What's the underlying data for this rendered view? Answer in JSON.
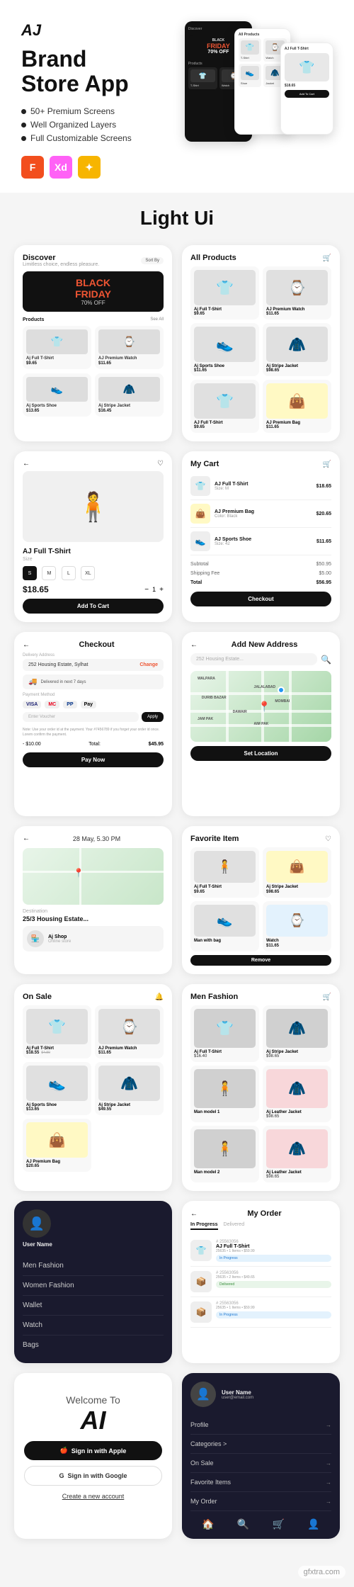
{
  "hero": {
    "logo": "AJ",
    "title": "Brand\nStore App",
    "bullets": [
      "50+ Premium Screens",
      "Well Organized Layers",
      "Full Customizable Screens"
    ],
    "tools": [
      "F",
      "Xd",
      "✦"
    ],
    "tool_labels": [
      "Figma",
      "Adobe XD",
      "Sketch"
    ]
  },
  "section_light_ui": "Light Ui",
  "screens": {
    "discover": {
      "title": "Discover",
      "subtitle": "Limitless choice, endless pleasure.",
      "sort_label": "Sort By",
      "banner": {
        "sale": "BLACK",
        "sale2": "FRIDAY",
        "discount": "70% OFF"
      },
      "products_label": "Products",
      "see_all": "See All",
      "items": [
        {
          "name": "Aj Full T-Shirt",
          "price": "$9.65",
          "old": ""
        },
        {
          "name": "AJ Premium Watch",
          "price": "$11.65",
          "old": ""
        },
        {
          "name": "Aj Sports Shoe",
          "price": "$13.65",
          "old": ""
        },
        {
          "name": "Aj Stripe Jacket",
          "price": "$16.45",
          "old": ""
        }
      ]
    },
    "all_products": {
      "title": "All Products",
      "items": [
        {
          "name": "Aj Full T-Shirt",
          "price": "$9.65"
        },
        {
          "name": "AJ Premium Watch",
          "price": "$11.65"
        },
        {
          "name": "Aj Sports Shoe",
          "price": "$11.65"
        },
        {
          "name": "Aj Stripe Jacket",
          "price": "$98.65"
        },
        {
          "name": "AJ Full T-Shirt",
          "price": "$9.65"
        },
        {
          "name": "AJ Premium Bag",
          "price": "$11.65"
        }
      ]
    },
    "product_detail": {
      "name": "AJ Full T-Shirt",
      "size_label": "Size",
      "sizes": [
        "S",
        "M",
        "L",
        "XL"
      ],
      "active_size": "S",
      "price": "$18.65",
      "old_price": "",
      "qty": 1,
      "add_to_cart": "Add To Cart"
    },
    "cart": {
      "title": "My Cart",
      "items": [
        {
          "name": "AJ Full T-Shirt",
          "sub": "Size: M",
          "price": "$18.65",
          "emoji": "👕"
        },
        {
          "name": "AJ Premium Bag",
          "sub": "Color: Black",
          "price": "$20.65",
          "emoji": "👜"
        },
        {
          "name": "AJ Sports Shoe",
          "sub": "Size: 42",
          "price": "$11.65",
          "emoji": "👟"
        }
      ],
      "subtotal_label": "Subtotal",
      "subtotal": "$50.95",
      "shipping_label": "Shipping Fee",
      "shipping": "$5.00",
      "total_label": "Total",
      "total": "$56.95",
      "checkout_btn": "Checkout"
    },
    "checkout": {
      "title": "Checkout",
      "address_label": "Delivery Address",
      "address_value": "252 Housing Estate, Sylhat",
      "change": "Change",
      "delivery_label": "Delivered in next 7 days",
      "payment_label": "Payment Method",
      "payment_methods": [
        "VISA",
        "MC",
        "PP",
        "Pay"
      ],
      "coupon_placeholder": "Enter Voucher",
      "note": "Note: Use your order id at the payment. Your #7456789 if you forget your order id once. Lorem confirm the payment.",
      "total_label": "Total:",
      "total": "$45.95",
      "tax_label": "- $10.00",
      "pay_now": "Pay Now"
    },
    "map": {
      "title": "Add New Address",
      "search_placeholder": "252 Housing Estate...",
      "set_location_btn": "Set Location"
    },
    "notification": {
      "title": "28 May, 5.30 PM",
      "subtitle": "Destination",
      "value": "25/3 Housing Estate...",
      "shop": "Aj Shop"
    },
    "favorite": {
      "title": "Favorite Item",
      "items": [
        {
          "name": "Aj Full T-Shirt",
          "price": "$9.65",
          "emoji": "👕"
        },
        {
          "name": "Aj Stripe Jacket",
          "price": "$98.65",
          "emoji": "🧥"
        },
        {
          "name": "Man with bag",
          "price": "",
          "emoji": "🧍"
        },
        {
          "name": "Watch",
          "price": "$11.65",
          "emoji": "⌚"
        }
      ],
      "remove_btn": "Remove"
    },
    "on_sale": {
      "title": "On Sale",
      "items": [
        {
          "name": "Aj Full T-Shirt",
          "price": "$18.55",
          "old": "$4.80",
          "emoji": "👕"
        },
        {
          "name": "AJ Premium Watch",
          "price": "$11.65",
          "old": "",
          "emoji": "⌚"
        },
        {
          "name": "Aj Sports Shoe",
          "price": "$13.65",
          "old": "",
          "emoji": "👟"
        },
        {
          "name": "Aj Stripe Jacket",
          "price": "$49.55",
          "old": "",
          "emoji": "🧥"
        },
        {
          "name": "AJ Premium Bag",
          "price": "$20.65",
          "old": "",
          "emoji": "👜"
        }
      ]
    },
    "men_fashion": {
      "title": "Men Fashion",
      "items": [
        {
          "name": "Aj Full T-Shirt",
          "price": "$16.40",
          "emoji": "👕"
        },
        {
          "name": "Aj Stripe Jacket",
          "price": "$98.65",
          "emoji": "🧥"
        },
        {
          "name": "Man model 1",
          "price": "",
          "emoji": "🧍"
        },
        {
          "name": "Aj Leather Jacket",
          "price": "$98.65",
          "emoji": "🧥"
        },
        {
          "name": "Man model 2",
          "price": "",
          "emoji": "🧍"
        },
        {
          "name": "Aj Leather Jacket",
          "price": "$98.65",
          "emoji": "🧥"
        }
      ]
    },
    "my_order": {
      "title": "My Order",
      "items": [
        {
          "id": "# 25563056",
          "name": "AJ Full T-Shirt",
          "status": "In Progress",
          "emoji": "👕",
          "sub": "25635 • 1 Items • $59.99"
        },
        {
          "id": "# 25563056",
          "name": "",
          "status": "Delivered",
          "emoji": "📦",
          "sub": "25635 • 2 Items • $49.65"
        },
        {
          "id": "# 25563056",
          "name": "",
          "status": "In Progress",
          "emoji": "📦",
          "sub": "25635 • 1 Items • $59.99"
        }
      ],
      "tab": "In Progress",
      "tab2": "Delivered"
    },
    "dark_menu": {
      "title": "",
      "items": [
        "Men Fashion",
        "Women Fashion",
        "Wallet",
        "Watch",
        "Bags"
      ]
    },
    "dark_profile": {
      "items": [
        "Profile",
        "Categories >",
        "On Sale",
        "Favorite Items",
        "My Order"
      ]
    },
    "welcome": {
      "welcome_to": "Welcome To",
      "app_name": "AI",
      "sign_apple": "Sign in with Apple",
      "sign_google": "Sign in with Google",
      "create": "Create a new account"
    }
  },
  "watermark": "gfxtra.com"
}
